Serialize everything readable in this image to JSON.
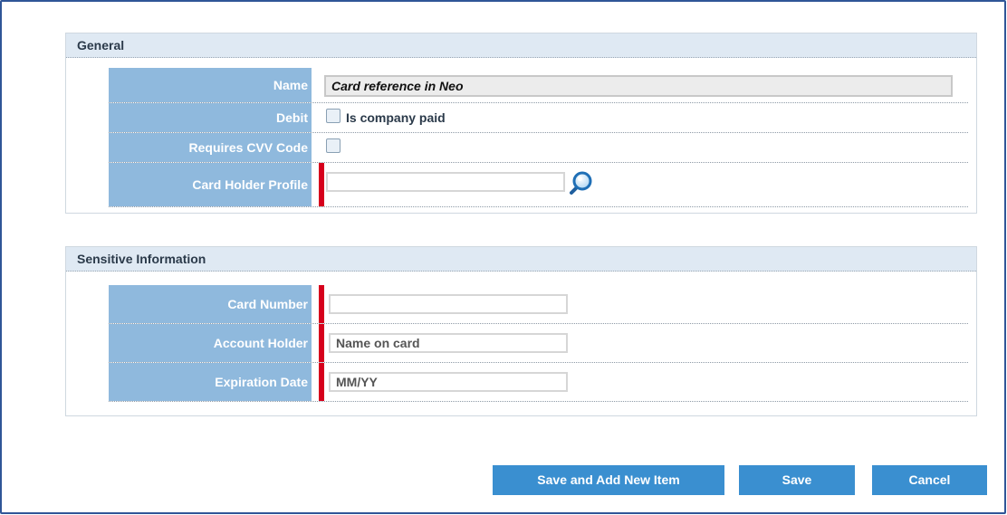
{
  "sections": [
    {
      "title": "General",
      "fields": {
        "name": {
          "label": "Name",
          "value": "Card reference in Neo"
        },
        "debit": {
          "label": "Debit",
          "checkbox_label": "Is company paid",
          "checked": false
        },
        "cvv": {
          "label": "Requires CVV Code",
          "checked": false
        },
        "card_holder_profile": {
          "label": "Card Holder Profile",
          "value": "",
          "required": true,
          "icon": "search-icon"
        }
      }
    },
    {
      "title": "Sensitive Information",
      "fields": {
        "card_number": {
          "label": "Card Number",
          "value": "",
          "required": true
        },
        "account_holder": {
          "label": "Account Holder",
          "placeholder": "Name on card",
          "required": true
        },
        "expiration_date": {
          "label": "Expiration Date",
          "placeholder": "MM/YY",
          "required": true
        }
      }
    }
  ],
  "buttons": {
    "save_and_add": "Save and Add New Item",
    "save": "Save",
    "cancel": "Cancel"
  },
  "colors": {
    "label_bg": "#8fb9dd",
    "header_bg": "#dfe9f3",
    "required": "#d6001c",
    "button": "#3a8fd0",
    "frame": "#2f5597"
  }
}
